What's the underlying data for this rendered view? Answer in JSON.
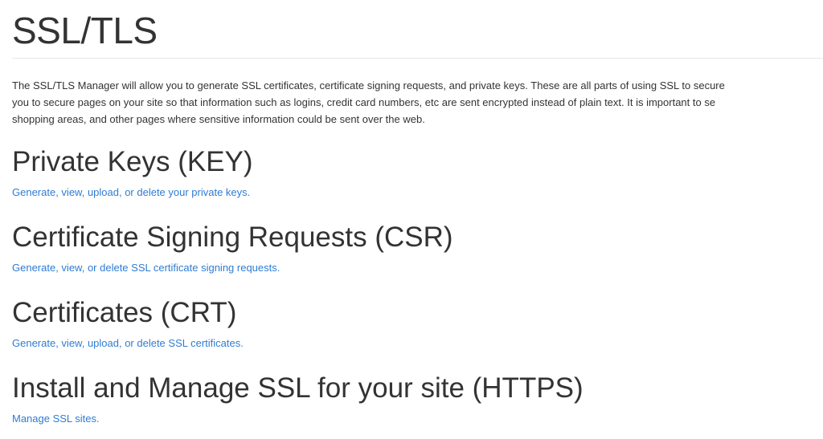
{
  "page": {
    "title": "SSL/TLS",
    "intro_lines": [
      "The SSL/TLS Manager will allow you to generate SSL certificates, certificate signing requests, and private keys. These are all parts of using SSL to secure",
      "you to secure pages on your site so that information such as logins, credit card numbers, etc are sent encrypted instead of plain text. It is important to se",
      "shopping areas, and other pages where sensitive information could be sent over the web."
    ]
  },
  "sections": [
    {
      "heading": "Private Keys (KEY)",
      "link": "Generate, view, upload, or delete your private keys."
    },
    {
      "heading": "Certificate Signing Requests (CSR)",
      "link": "Generate, view, or delete SSL certificate signing requests."
    },
    {
      "heading": "Certificates (CRT)",
      "link": "Generate, view, upload, or delete SSL certificates."
    },
    {
      "heading": "Install and Manage SSL for your site (HTTPS)",
      "link": "Manage SSL sites."
    }
  ],
  "colors": {
    "text": "#333333",
    "link": "#2f7cd4",
    "divider": "#e8e8e8"
  }
}
